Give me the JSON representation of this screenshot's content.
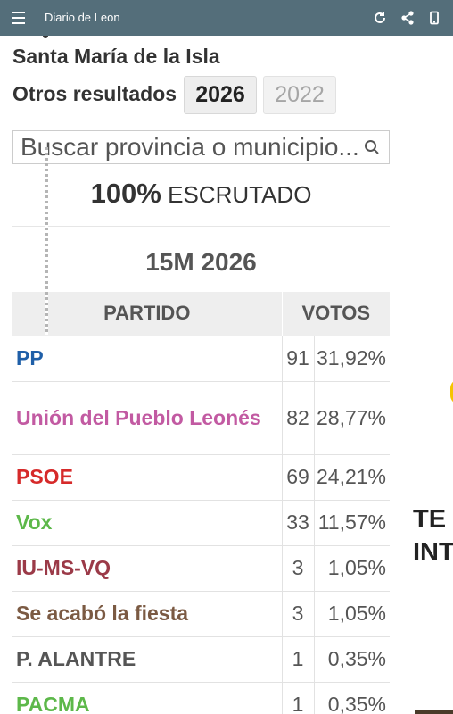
{
  "app": {
    "title": "Diario de Leon",
    "icons": [
      "menu-icon",
      "refresh-icon",
      "share-icon",
      "phone-icon"
    ]
  },
  "place": "Santa María de la Isla",
  "otros": {
    "label": "Otros resultados",
    "years": [
      "2026",
      "2022"
    ],
    "active_year": "2026"
  },
  "search": {
    "placeholder": "Buscar provincia o municipio..."
  },
  "scrutiny": {
    "percent": "100%",
    "label": "ESCRUTADO"
  },
  "election": {
    "title": "15M 2026"
  },
  "table": {
    "headers": [
      "PARTIDO",
      "VOTOS"
    ],
    "rows": [
      {
        "party": "PP",
        "votes": "91",
        "pct": "31,92%",
        "color": "#1f5fa8"
      },
      {
        "party": "Unión del Pueblo Leonés",
        "votes": "82",
        "pct": "28,77%",
        "color": "#c25aa2"
      },
      {
        "party": "PSOE",
        "votes": "69",
        "pct": "24,21%",
        "color": "#d62a2a"
      },
      {
        "party": "Vox",
        "votes": "33",
        "pct": "11,57%",
        "color": "#5db84a"
      },
      {
        "party": "IU-MS-VQ",
        "votes": "3",
        "pct": "1,05%",
        "color": "#9b3a48"
      },
      {
        "party": "Se acabó la fiesta",
        "votes": "3",
        "pct": "1,05%",
        "color": "#7b5a43"
      },
      {
        "party": "P. ALANTRE",
        "votes": "1",
        "pct": "0,35%",
        "color": "#555555"
      },
      {
        "party": "PACMA",
        "votes": "1",
        "pct": "0,35%",
        "color": "#5db84a"
      }
    ]
  },
  "ad": {
    "lines": [
      "TE",
      "INT"
    ]
  }
}
